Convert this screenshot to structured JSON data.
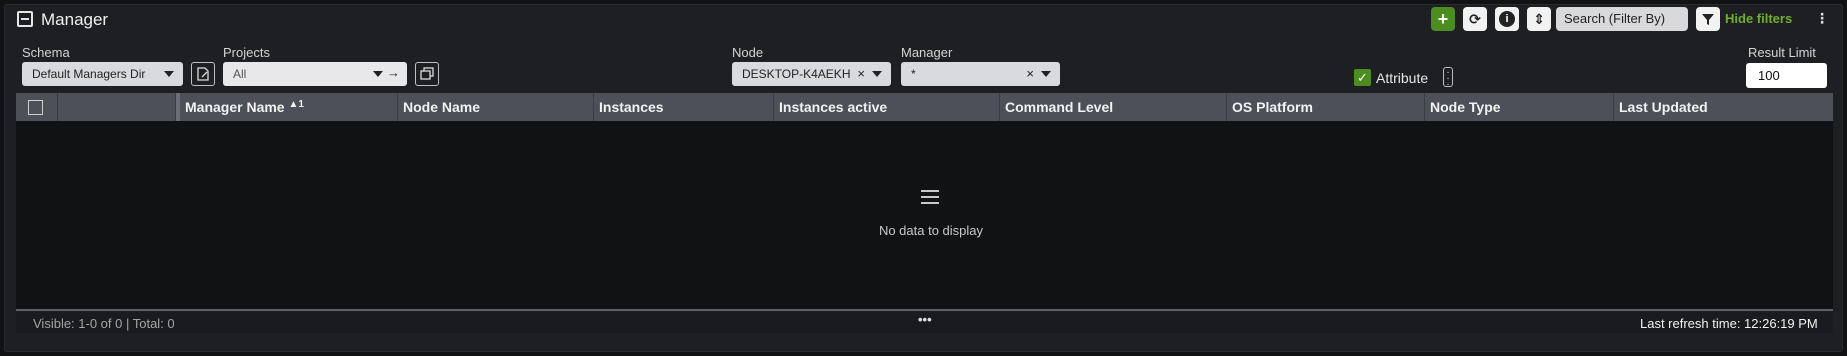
{
  "panel": {
    "title": "Manager"
  },
  "toolbar": {
    "add_icon": "+",
    "refresh_icon": "⟳",
    "info_icon": "i",
    "sort_icon": "⇕",
    "search_placeholder": "Search (Filter By)",
    "filter_icon": "filter-icon",
    "hide_filters_label": "Hide filters",
    "more_icon": "⋮",
    "accent_color": "#4c8d1f"
  },
  "filters": {
    "schema_label": "Schema",
    "schema_value": "Default Managers Dir",
    "projects_label": "Projects",
    "projects_value": "All",
    "node_label": "Node",
    "node_value": "DESKTOP-K4AEKH",
    "manager_label": "Manager",
    "manager_value": "*",
    "attribute_label": "Attribute",
    "attribute_checked": true,
    "result_limit_label": "Result Limit",
    "result_limit_value": "100"
  },
  "grid": {
    "columns": [
      "Manager Name",
      "Node Name",
      "Instances",
      "Instances active",
      "Command Level",
      "OS Platform",
      "Node Type",
      "Last Updated"
    ],
    "sort_indicator": "▲1",
    "empty_message": "No data to display",
    "rows": []
  },
  "footer": {
    "visible_text": "Visible: 1-0 of 0 | Total: 0",
    "more_text": "•••",
    "refresh_text": "Last refresh time: 12:26:19 PM"
  }
}
